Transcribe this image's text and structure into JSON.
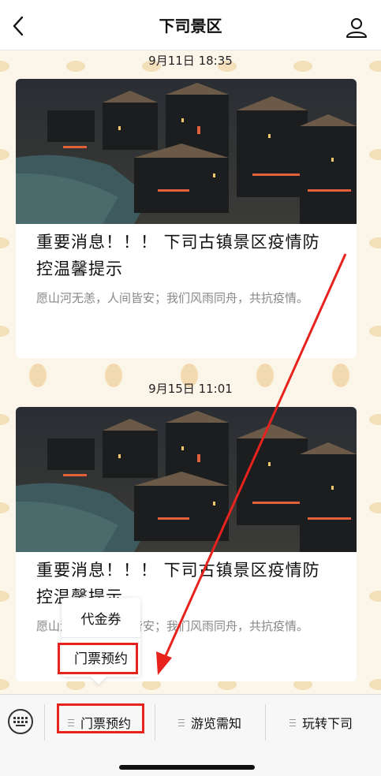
{
  "header": {
    "title": "下司景区"
  },
  "feed": [
    {
      "timestamp": "9月11日 18:35",
      "title": "重要消息！！！ 下司古镇景区疫情防控温馨提示",
      "desc": "愿山河无恙，人间皆安；我们风雨同舟，共抗疫情。"
    },
    {
      "timestamp": "9月15日 11:01",
      "title": "重要消息！！！ 下司古镇景区疫情防控温馨提示",
      "desc": "愿山河无恙，人间皆安；我们风雨同舟，共抗疫情。"
    }
  ],
  "popup": {
    "items": [
      "代金券",
      "门票预约"
    ]
  },
  "bottom_nav": {
    "items": [
      "门票预约",
      "游览需知",
      "玩转下司"
    ]
  },
  "colors": {
    "highlight": "#e8231e",
    "accent_bg": "#fcf6ea"
  }
}
